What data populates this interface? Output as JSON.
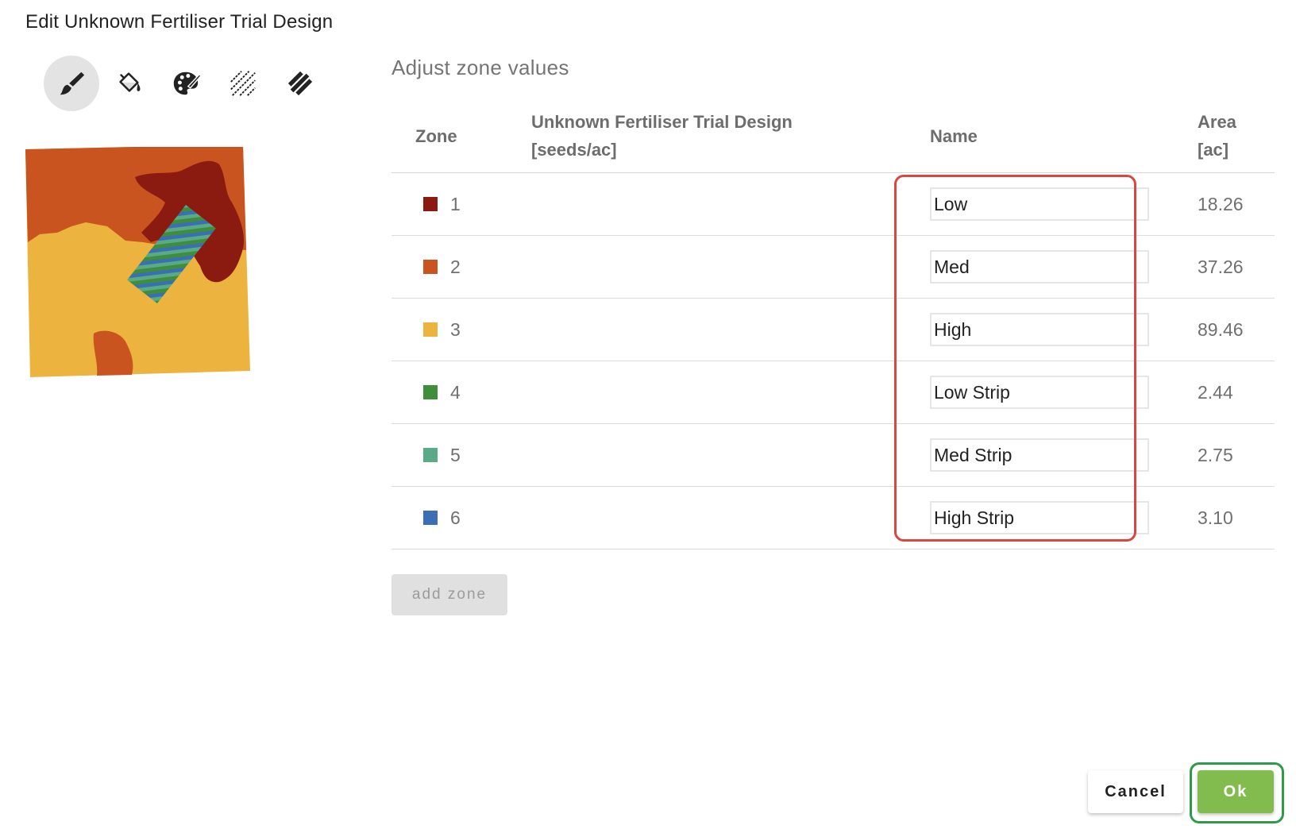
{
  "dialog": {
    "title": "Edit Unknown Fertiliser Trial Design"
  },
  "toolbar": {
    "tools": [
      {
        "icon": "paint-brush-icon",
        "active": true
      },
      {
        "icon": "paint-bucket-icon",
        "active": false
      },
      {
        "icon": "palette-icon",
        "active": false
      },
      {
        "icon": "thin-stripes-icon",
        "active": false
      },
      {
        "icon": "thick-stripes-icon",
        "active": false
      }
    ]
  },
  "zones_panel": {
    "title": "Adjust zone values",
    "headers": {
      "zone": "Zone",
      "rate_line1": "Unknown Fertiliser Trial Design",
      "rate_line2": "[seeds/ac]",
      "name": "Name",
      "area_line1": "Area",
      "area_line2": "[ac]"
    },
    "rows": [
      {
        "zone": "1",
        "color": "#8b1a10",
        "rate": "",
        "name": "Low",
        "area": "18.26"
      },
      {
        "zone": "2",
        "color": "#c9541f",
        "rate": "",
        "name": "Med",
        "area": "37.26"
      },
      {
        "zone": "3",
        "color": "#ecb43e",
        "rate": "",
        "name": "High",
        "area": "89.46"
      },
      {
        "zone": "4",
        "color": "#3f8f3a",
        "rate": "",
        "name": "Low Strip",
        "area": "2.44"
      },
      {
        "zone": "5",
        "color": "#58ab86",
        "rate": "",
        "name": "Med Strip",
        "area": "2.75"
      },
      {
        "zone": "6",
        "color": "#3a6fb5",
        "rate": "",
        "name": "High Strip",
        "area": "3.10"
      }
    ],
    "add_zone_label": "add zone"
  },
  "footer": {
    "cancel_label": "Cancel",
    "ok_label": "Ok"
  }
}
